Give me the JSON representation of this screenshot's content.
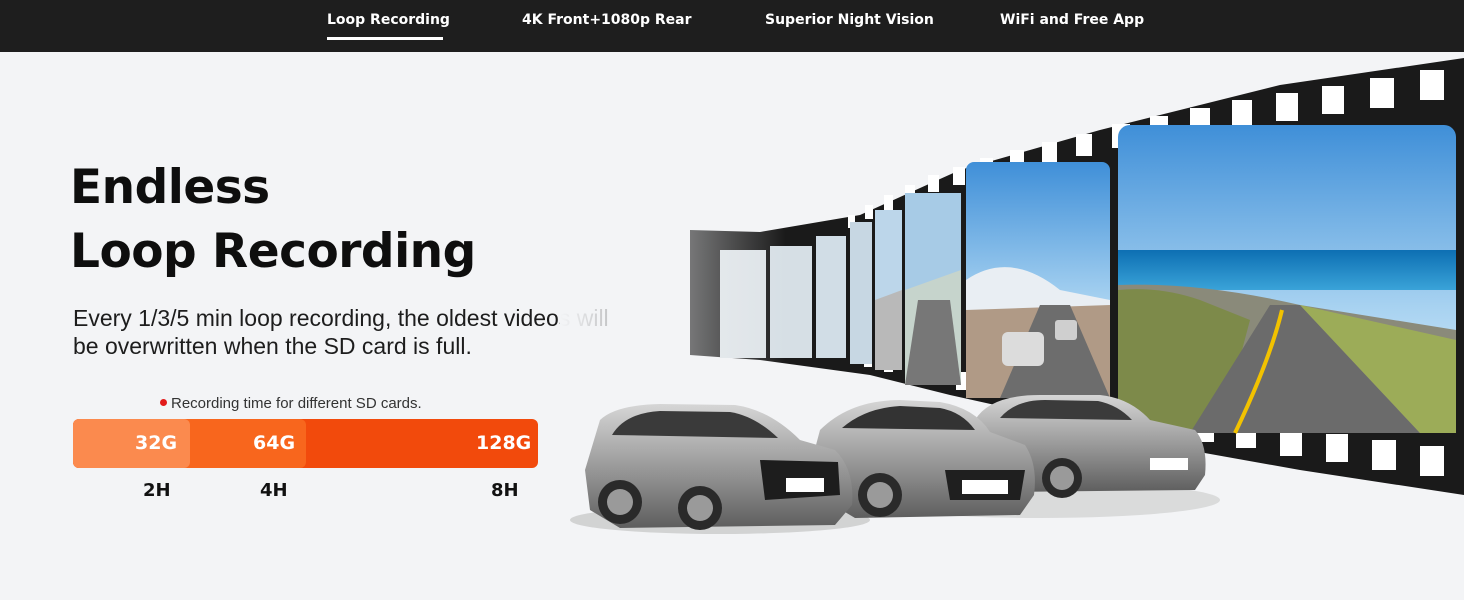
{
  "nav": {
    "items": [
      {
        "label": "Loop Recording",
        "active": true
      },
      {
        "label": "4K Front+1080p Rear",
        "active": false
      },
      {
        "label": "Superior Night Vision",
        "active": false
      },
      {
        "label": "WiFi and Free App",
        "active": false
      }
    ]
  },
  "hero": {
    "title_line1": "Endless",
    "title_line2": "Loop Recording",
    "description": "Every 1/3/5 min loop recording, the oldest videos will be overwritten when the SD card is full.",
    "note": "Recording time for different SD cards."
  },
  "capacity": {
    "cards": [
      {
        "size": "32G",
        "time": "2H",
        "color": "#fb8a4e"
      },
      {
        "size": "64G",
        "time": "4H",
        "color": "#f8661d"
      },
      {
        "size": "128G",
        "time": "8H",
        "color": "#f24a0c"
      }
    ]
  },
  "colors": {
    "nav_bg": "#1e1e1e",
    "page_bg": "#f3f4f6",
    "accent": "#f24a0c",
    "note_dot": "#e21b1b"
  },
  "illustration": {
    "icon": "film-strip-with-cars"
  }
}
